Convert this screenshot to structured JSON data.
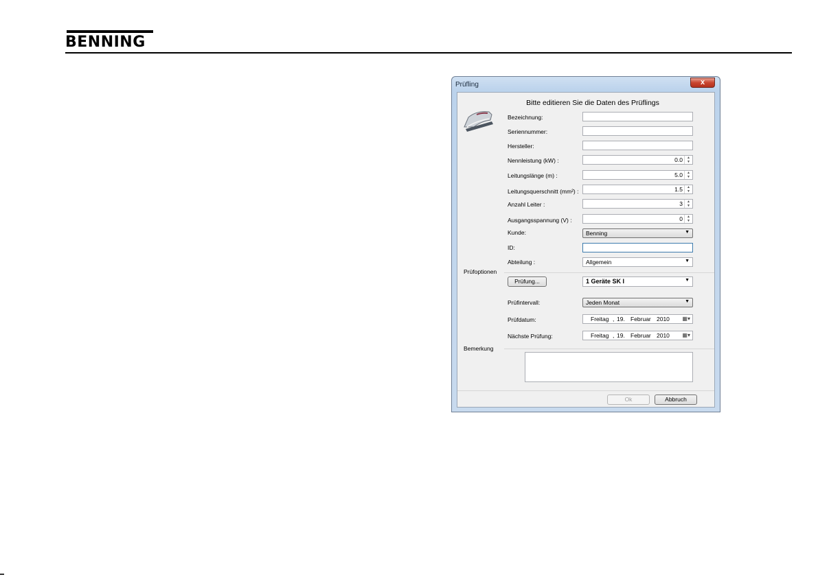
{
  "brand": {
    "logo_text": "BENNING"
  },
  "dialog": {
    "title": "Prüfling",
    "close_glyph": "x",
    "heading": "Bitte editieren Sie die Daten des Prüflings",
    "fields": {
      "bezeichnung_label": "Bezeichnung:",
      "bezeichnung_value": "",
      "seriennummer_label": "Seriennummer:",
      "seriennummer_value": "",
      "hersteller_label": "Hersteller:",
      "hersteller_value": "",
      "nennleistung_label": "Nennleistung (kW) :",
      "nennleistung_value": "0.0",
      "leitungslaenge_label": "Leitungslänge (m) :",
      "leitungslaenge_value": "5.0",
      "leitungsquerschnitt_label": "Leitungsquerschnitt (mm²) :",
      "leitungsquerschnitt_value": "1.5",
      "anzahl_leiter_label": "Anzahl Leiter :",
      "anzahl_leiter_value": "3",
      "ausgangsspannung_label": "Ausgangsspannung (V) :",
      "ausgangsspannung_value": "0",
      "kunde_label": "Kunde:",
      "kunde_value": "Benning",
      "id_label": "ID:",
      "id_value": "",
      "abteilung_label": "Abteilung :",
      "abteilung_value": "Allgemein"
    },
    "pruefoptionen": {
      "section_label": "Prüfoptionen",
      "pruefung_button": "Prüfung...",
      "pruefung_value": "1 Geräte SK I",
      "intervall_label": "Prüfintervall:",
      "intervall_value": "Jeden Monat",
      "pruefdatum_label": "Prüfdatum:",
      "naechste_label": "Nächste Prüfung:",
      "date": {
        "weekday": "Freitag",
        "day": "19.",
        "month": "Februar",
        "year": "2010"
      }
    },
    "bemerkung": {
      "section_label": "Bemerkung",
      "value": ""
    },
    "footer": {
      "ok_label": "Ok",
      "cancel_label": "Abbruch"
    },
    "icons": {
      "close": "close-icon",
      "spin_up": "▲",
      "spin_down": "▼",
      "dropdown": "▼",
      "calendar": "calendar-icon"
    }
  }
}
